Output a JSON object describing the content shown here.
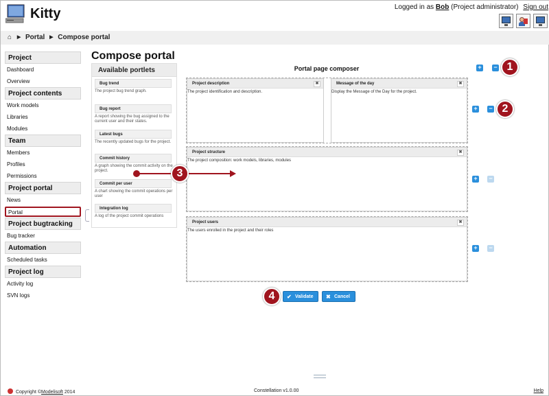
{
  "header": {
    "title": "Kitty",
    "logged_in_prefix": "Logged in as",
    "user": "Bob",
    "role": "(Project administrator)",
    "signout": "Sign out"
  },
  "breadcrumb": [
    "Portal",
    "Compose portal"
  ],
  "sidebar": [
    {
      "section": "Project",
      "items": [
        "Dashboard",
        "Overview"
      ]
    },
    {
      "section": "Project contents",
      "items": [
        "Work models",
        "Libraries",
        "Modules"
      ]
    },
    {
      "section": "Team",
      "items": [
        "Members",
        "Profiles",
        "Permissions"
      ]
    },
    {
      "section": "Project portal",
      "items": [
        "News",
        "Portal"
      ]
    },
    {
      "section": "Project bugtracking",
      "items": [
        "Bug tracker"
      ]
    },
    {
      "section": "Automation",
      "items": [
        "Scheduled tasks"
      ]
    },
    {
      "section": "Project log",
      "items": [
        "Activity log",
        "SVN logs"
      ]
    }
  ],
  "active_item": "Portal",
  "page_title": "Compose portal",
  "portlets": {
    "title": "Available portlets",
    "items": [
      {
        "title": "Bug trend",
        "desc": "The project bug trend graph."
      },
      {
        "title": "Bug report",
        "desc": "A report showing the bug assigned to the current user and their states."
      },
      {
        "title": "Latest bugs",
        "desc": "The recently updated bugs for the project."
      },
      {
        "title": "Commit history",
        "desc": "A graph showing the commit activity on the project."
      },
      {
        "title": "Commit per user",
        "desc": "A chart showing the commit operations per user"
      },
      {
        "title": "Integration log",
        "desc": "A log of the project commit operations"
      }
    ]
  },
  "composer": {
    "title": "Portal page composer",
    "boxes": [
      {
        "title": "Project description",
        "desc": "The project identification and description."
      },
      {
        "title": "Message of the day",
        "desc": "Display the Message of the Day for the project."
      },
      {
        "title": "Project structure",
        "desc": "The project composition: work models, libraries, modules"
      },
      {
        "title": "Project users",
        "desc": "The users enrolled in the project and their roles"
      }
    ],
    "close_glyph": "✖",
    "plus_glyph": "+",
    "minus_glyph": "−"
  },
  "callouts": [
    "1",
    "2",
    "3",
    "4"
  ],
  "buttons": {
    "validate": "Validate",
    "cancel": "Cancel",
    "validate_icon": "✔",
    "cancel_icon": "✖"
  },
  "footer": {
    "copyright": "Copyright ©",
    "company": "Modelisoft",
    "year": "2014",
    "version": "Constellation v1.0.00",
    "help": "Help"
  },
  "colors": {
    "accent": "#2a8fdc",
    "callout": "#a0141e"
  }
}
